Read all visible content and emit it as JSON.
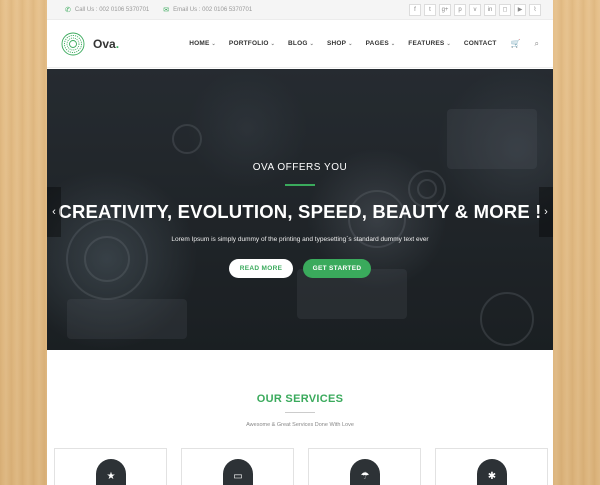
{
  "topbar": {
    "call_label": "Call Us : 002 0106 5370701",
    "email_label": "Email Us : 002 0106 5370701",
    "social": [
      "f",
      "t",
      "g+",
      "p",
      "v",
      "in",
      "◻",
      "▶",
      "⌇"
    ]
  },
  "header": {
    "logo_text": "Ova",
    "logo_dot": ".",
    "nav": [
      "HOME",
      "PORTFOLIO",
      "BLOG",
      "SHOP",
      "PAGES",
      "FEATURES",
      "CONTACT"
    ],
    "cart_icon": "cart-icon",
    "search_icon": "search-icon"
  },
  "hero": {
    "kicker": "OVA OFFERS YOU",
    "title": "CREATIVITY, EVOLUTION, SPEED, BEAUTY & MORE !",
    "subtitle": "Lorem Ipsum is simply dummy of the printing and typesetting`s standard dummy text ever",
    "btn_read_more": "READ MORE",
    "btn_get_started": "GET STARTED",
    "arrow_left": "‹",
    "arrow_right": "›"
  },
  "services": {
    "title": "OUR SERVICES",
    "subtitle": "Awesome & Great Services Done With Love",
    "card_icons": [
      "★",
      "▭",
      "☂",
      "✱"
    ]
  },
  "colors": {
    "accent": "#3aaa5c",
    "hero_bg": "#23282c"
  }
}
